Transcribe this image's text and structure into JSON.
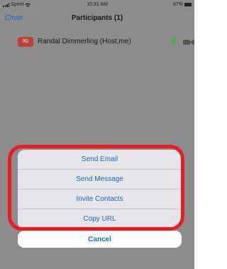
{
  "status_bar": {
    "carrier": "Sprint",
    "time": "10:31 AM",
    "battery": "87%"
  },
  "nav": {
    "close_label": "Close",
    "title": "Participants (1)"
  },
  "participant": {
    "initials": "RD",
    "name": "Randal Dimmerling (Host,me)"
  },
  "actions": [
    {
      "label": "Send Email"
    },
    {
      "label": "Send Message"
    },
    {
      "label": "Invite Contacts"
    },
    {
      "label": "Copy URL"
    }
  ],
  "cancel_label": "Cancel",
  "colors": {
    "accent": "#1f67b8",
    "highlight": "#ee1c1c",
    "overlay": "#8c8c8e",
    "avatar": "#c0433a"
  }
}
